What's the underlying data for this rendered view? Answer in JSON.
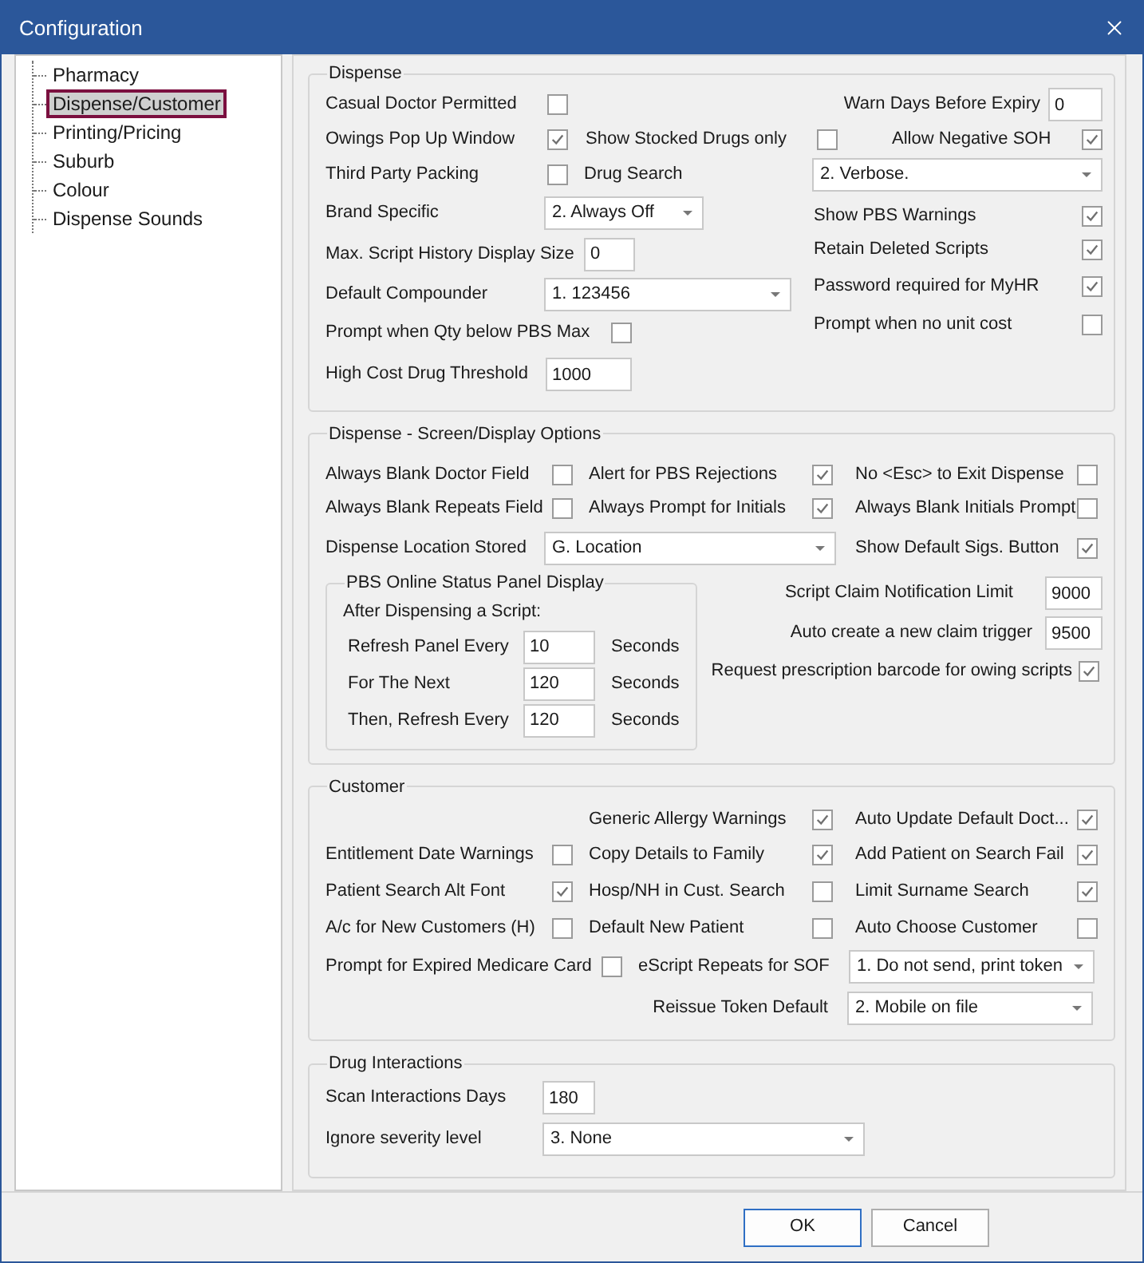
{
  "window": {
    "title": "Configuration"
  },
  "sidebar": {
    "items": [
      {
        "label": "Pharmacy",
        "selected": false
      },
      {
        "label": "Dispense/Customer",
        "selected": true
      },
      {
        "label": "Printing/Pricing",
        "selected": false
      },
      {
        "label": "Suburb",
        "selected": false
      },
      {
        "label": "Colour",
        "selected": false
      },
      {
        "label": "Dispense Sounds",
        "selected": false
      }
    ]
  },
  "dispense": {
    "title": "Dispense",
    "items": [
      {
        "kind": "checkbox",
        "label": "Casual Doctor Permitted",
        "checked": false
      },
      {
        "kind": "number",
        "label": "Warn Days Before Expiry",
        "value": "0"
      },
      {
        "kind": "checkbox",
        "label": "Owings Pop Up Window",
        "checked": true
      },
      {
        "kind": "checkbox",
        "label": "Show Stocked Drugs only",
        "checked": false
      },
      {
        "kind": "checkbox",
        "label": "Allow Negative SOH",
        "checked": true
      },
      {
        "kind": "checkbox",
        "label": "Third Party Packing",
        "checked": false
      },
      {
        "kind": "dropdown",
        "label": "Drug Search",
        "value": "2. Verbose."
      },
      {
        "kind": "dropdown",
        "label": "Brand Specific",
        "value": "2. Always Off"
      },
      {
        "kind": "checkbox",
        "label": "Show PBS Warnings",
        "checked": true
      },
      {
        "kind": "number",
        "label": "Max. Script History Display Size",
        "value": "0"
      },
      {
        "kind": "checkbox",
        "label": "Retain Deleted Scripts",
        "checked": true
      },
      {
        "kind": "dropdown",
        "label": "Default Compounder",
        "value": "1. 123456"
      },
      {
        "kind": "checkbox",
        "label": "Password required for MyHR",
        "checked": true
      },
      {
        "kind": "checkbox",
        "label": "Prompt when Qty below PBS Max",
        "checked": false
      },
      {
        "kind": "checkbox",
        "label": "Prompt when no unit cost",
        "checked": false
      },
      {
        "kind": "number",
        "label": "High Cost Drug Threshold",
        "value": "1000"
      }
    ]
  },
  "display_options": {
    "title": "Dispense - Screen/Display Options",
    "items": [
      {
        "kind": "checkbox",
        "label": "Always Blank Doctor Field",
        "checked": false
      },
      {
        "kind": "checkbox",
        "label": "Alert for PBS Rejections",
        "checked": true
      },
      {
        "kind": "checkbox",
        "label": "No <Esc> to Exit Dispense",
        "checked": false
      },
      {
        "kind": "checkbox",
        "label": "Always Blank Repeats Field",
        "checked": false
      },
      {
        "kind": "checkbox",
        "label": "Always Prompt for Initials",
        "checked": true
      },
      {
        "kind": "checkbox",
        "label": "Always Blank Initials Prompt",
        "checked": false
      },
      {
        "kind": "dropdown",
        "label": "Dispense Location Stored",
        "value": "G. Location"
      },
      {
        "kind": "checkbox",
        "label": "Show Default Sigs. Button",
        "checked": true
      },
      {
        "kind": "number",
        "label": "Script Claim Notification Limit",
        "value": "9000"
      },
      {
        "kind": "number",
        "label": "Auto create a new claim trigger",
        "value": "9500"
      },
      {
        "kind": "checkbox",
        "label": "Request prescription barcode for owing scripts",
        "checked": true
      }
    ],
    "pbs_panel": {
      "title": "PBS Online Status Panel Display",
      "subtitle": "After Dispensing a Script:",
      "rows": [
        {
          "label": "Refresh Panel Every",
          "value": "10",
          "unit": "Seconds"
        },
        {
          "label": "For The Next",
          "value": "120",
          "unit": "Seconds"
        },
        {
          "label": "Then, Refresh Every",
          "value": "120",
          "unit": "Seconds"
        }
      ]
    }
  },
  "customer": {
    "title": "Customer",
    "items": [
      {
        "kind": "checkbox",
        "label": "Generic Allergy Warnings",
        "checked": true
      },
      {
        "kind": "checkbox",
        "label": "Auto Update Default Doct...",
        "checked": true
      },
      {
        "kind": "checkbox",
        "label": "Entitlement Date Warnings",
        "checked": false
      },
      {
        "kind": "checkbox",
        "label": "Copy Details to Family",
        "checked": true
      },
      {
        "kind": "checkbox",
        "label": "Add Patient on Search Fail",
        "checked": true
      },
      {
        "kind": "checkbox",
        "label": "Patient Search Alt Font",
        "checked": true
      },
      {
        "kind": "checkbox",
        "label": "Hosp/NH in Cust. Search",
        "checked": false
      },
      {
        "kind": "checkbox",
        "label": "Limit Surname Search",
        "checked": true
      },
      {
        "kind": "checkbox",
        "label": "A/c for New Customers (H)",
        "checked": false
      },
      {
        "kind": "checkbox",
        "label": "Default New Patient",
        "checked": false
      },
      {
        "kind": "checkbox",
        "label": "Auto Choose Customer",
        "checked": false
      },
      {
        "kind": "checkbox",
        "label": "Prompt for Expired Medicare Card",
        "checked": false
      },
      {
        "kind": "dropdown",
        "label": "eScript Repeats for SOF",
        "value": "1. Do not send, print token"
      },
      {
        "kind": "dropdown",
        "label": "Reissue Token Default",
        "value": "2. Mobile on file"
      }
    ]
  },
  "drug_interactions": {
    "title": "Drug Interactions",
    "items": [
      {
        "kind": "number",
        "label": "Scan Interactions Days",
        "value": "180"
      },
      {
        "kind": "dropdown",
        "label": "Ignore severity level",
        "value": "3. None"
      }
    ]
  },
  "buttons": [
    {
      "label": "OK",
      "kind": "default"
    },
    {
      "label": "Cancel",
      "kind": "normal"
    }
  ]
}
